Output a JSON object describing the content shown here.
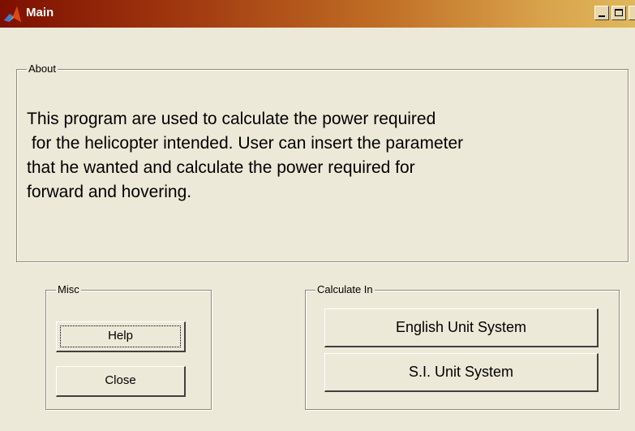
{
  "window": {
    "title": "Main",
    "icon": "matlab-icon",
    "controls": [
      "minimize-icon",
      "maximize-icon"
    ]
  },
  "about": {
    "legend": "About",
    "text": "This program are used to calculate the power required\n for the helicopter intended. User can insert the parameter\nthat he wanted and calculate the power required for\nforward and hovering."
  },
  "misc": {
    "legend": "Misc",
    "help_label": "Help",
    "close_label": "Close"
  },
  "calculate": {
    "legend": "Calculate In",
    "english_label": "English Unit System",
    "si_label": "S.I. Unit System"
  },
  "colors": {
    "titlebar_start": "#7d0f00",
    "titlebar_end": "#e0b85c",
    "window_bg": "#ece9d8"
  }
}
